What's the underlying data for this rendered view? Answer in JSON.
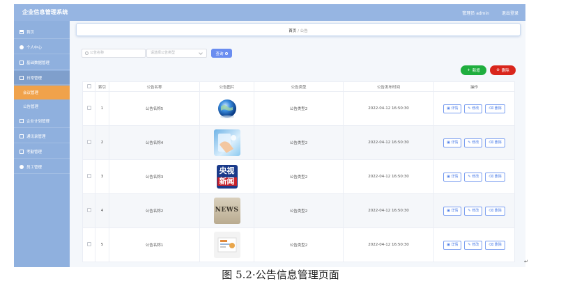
{
  "header": {
    "app_title": "企业信息管理系统",
    "admin_text": "管理员 admin",
    "logout_label": "退出登录"
  },
  "sidebar": {
    "items": [
      {
        "label": "首页",
        "icon": "home-icon"
      },
      {
        "label": "个人中心",
        "icon": "user-icon"
      },
      {
        "label": "基础数据管理",
        "icon": "grid-icon"
      },
      {
        "label": "日常管理",
        "icon": "grid-icon"
      },
      {
        "label": "会议管理"
      },
      {
        "label": "公告管理"
      },
      {
        "label": "企业计划管理",
        "icon": "grid-icon"
      },
      {
        "label": "通讯录管理",
        "icon": "grid-icon"
      },
      {
        "label": "考勤管理",
        "icon": "grid-icon"
      },
      {
        "label": "员工管理",
        "icon": "user-icon"
      }
    ]
  },
  "breadcrumb": {
    "home": "首页",
    "separator": "/",
    "current": "公告"
  },
  "search": {
    "name_placeholder": "公告名称",
    "type_placeholder": "请选择公告类型",
    "query_label": "查询"
  },
  "actions": {
    "add_label": "新增",
    "delete_label": "删除"
  },
  "table": {
    "headers": [
      "索引",
      "公告名称",
      "公告图片",
      "公告类型",
      "公告发布时间",
      "操作"
    ],
    "rows": [
      {
        "index": "1",
        "name": "公告名称5",
        "type": "公告类型2",
        "time": "2022-04-12 16:50:30",
        "image": "globe"
      },
      {
        "index": "2",
        "name": "公告名称4",
        "type": "公告类型2",
        "time": "2022-04-12 16:50:30",
        "image": "hand"
      },
      {
        "index": "3",
        "name": "公告名称3",
        "type": "公告类型2",
        "time": "2022-04-12 16:50:30",
        "image": "cctv"
      },
      {
        "index": "4",
        "name": "公告名称2",
        "type": "公告类型2",
        "time": "2022-04-12 16:50:30",
        "image": "news"
      },
      {
        "index": "5",
        "name": "公告名称1",
        "type": "公告类型2",
        "time": "2022-04-12 16:50:30",
        "image": "leaflet"
      }
    ],
    "op_labels": {
      "detail": "详情",
      "edit": "修改",
      "delete": "删除"
    },
    "cctv_text": {
      "top": "央视",
      "bottom": "新闻"
    },
    "news_text": "NEWS"
  },
  "caption": "图 5.2·公告信息管理页面",
  "colors": {
    "topbar": "#96b5e2",
    "sidebar": "#8fb0de",
    "active": "#f0a24b",
    "add": "#1fae3e",
    "delete": "#d9261c",
    "query": "#6a8df0"
  }
}
